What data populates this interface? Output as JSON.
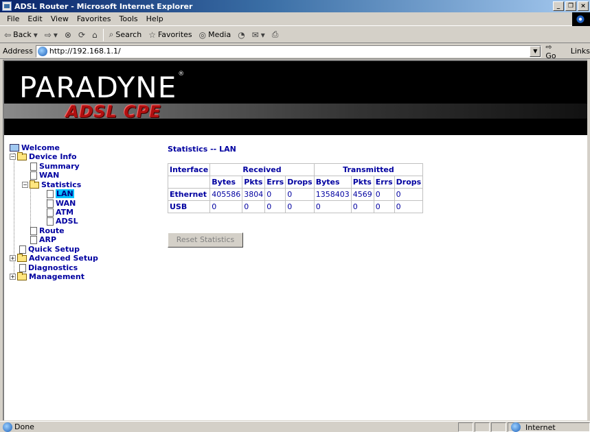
{
  "window": {
    "title": "ADSL Router - Microsoft Internet Explorer",
    "buttons": [
      "_",
      "❐",
      "×"
    ]
  },
  "menu": [
    "File",
    "Edit",
    "View",
    "Favorites",
    "Tools",
    "Help"
  ],
  "toolbar": {
    "back": "Back",
    "search": "Search",
    "favorites": "Favorites",
    "media": "Media"
  },
  "address": {
    "label": "Address",
    "url": "http://192.168.1.1/",
    "go": "Go",
    "links": "Links"
  },
  "banner": {
    "brand": "PARADYNE",
    "reg": "®",
    "product": "ADSL CPE"
  },
  "tree": {
    "welcome": "Welcome",
    "device_info": "Device Info",
    "summary": "Summary",
    "wan": "WAN",
    "statistics": "Statistics",
    "stat_lan": "LAN",
    "stat_wan": "WAN",
    "stat_atm": "ATM",
    "stat_adsl": "ADSL",
    "route": "Route",
    "arp": "ARP",
    "quick_setup": "Quick Setup",
    "advanced_setup": "Advanced Setup",
    "diagnostics": "Diagnostics",
    "management": "Management"
  },
  "main": {
    "title": "Statistics -- LAN",
    "reset_button": "Reset Statistics",
    "table": {
      "interface_header": "Interface",
      "received_header": "Received",
      "transmitted_header": "Transmitted",
      "subheaders": [
        "Bytes",
        "Pkts",
        "Errs",
        "Drops",
        "Bytes",
        "Pkts",
        "Errs",
        "Drops"
      ],
      "rows": [
        {
          "name": "Ethernet",
          "values": [
            "405586",
            "3804",
            "0",
            "0",
            "1358403",
            "4569",
            "0",
            "0"
          ]
        },
        {
          "name": "USB",
          "values": [
            "0",
            "0",
            "0",
            "0",
            "0",
            "0",
            "0",
            "0"
          ]
        }
      ]
    }
  },
  "status": {
    "text": "Done",
    "zone": "Internet"
  }
}
